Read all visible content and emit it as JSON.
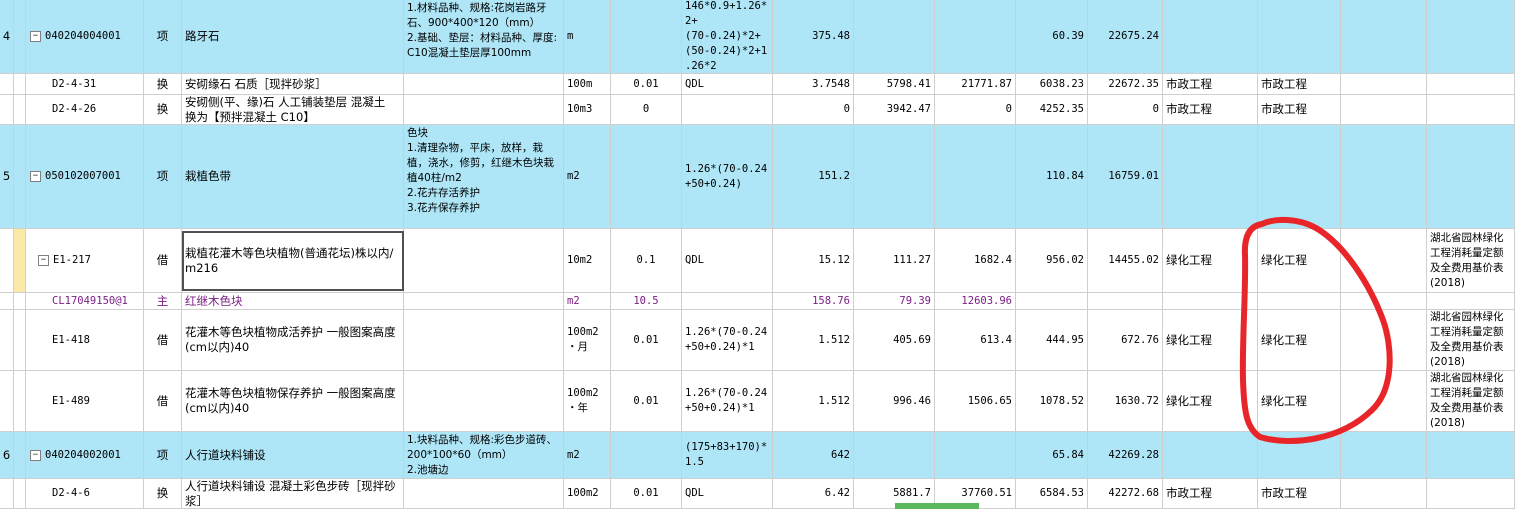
{
  "rows": [
    {
      "no": "4",
      "code": "040204004001",
      "type": "项",
      "name": "路牙石",
      "features": "1.材料品种、规格:花岗岩路牙石、900*400*120（mm）\n2.基础、垫层：材料品种、厚度:C10混凝土垫层厚100mm",
      "unit": "m",
      "qty_coef": "",
      "formula": "146*0.9+1.26*2+\n(70-0.24)*2+\n(50-0.24)*2+1\n.26*2",
      "quantity": "375.48",
      "price1": "",
      "total1": "",
      "unit_price": "60.39",
      "amount": "22675.24",
      "cat1": "",
      "cat2": "",
      "quota_lib": ""
    },
    {
      "no": "",
      "code": "D2-4-31",
      "type": "换",
      "name": "安砌缘石 石质［现拌砂浆］",
      "features": "",
      "unit": "100m",
      "qty_coef": "0.01",
      "formula": "QDL",
      "quantity": "3.7548",
      "price1": "5798.41",
      "total1": "21771.87",
      "unit_price": "6038.23",
      "amount": "22672.35",
      "cat1": "市政工程",
      "cat2": "市政工程",
      "quota_lib": ""
    },
    {
      "no": "",
      "code": "D2-4-26",
      "type": "换",
      "name": "安砌侧(平、缘)石 人工铺装垫层 混凝土 换为【预拌混凝土 C10】",
      "features": "",
      "unit": "10m3",
      "qty_coef": "0",
      "formula": "",
      "quantity": "0",
      "price1": "3942.47",
      "total1": "0",
      "unit_price": "4252.35",
      "amount": "0",
      "cat1": "市政工程",
      "cat2": "市政工程",
      "quota_lib": ""
    },
    {
      "no": "5",
      "code": "050102007001",
      "type": "项",
      "name": "栽植色带",
      "features": "色块\n1.清理杂物，平床，放样，栽植，浇水，修剪，红继木色块栽植40柱/m2\n2.花卉存活养护\n3.花卉保存养护",
      "unit": "m2",
      "qty_coef": "",
      "formula": "1.26*(70-0.24\n+50+0.24)",
      "quantity": "151.2",
      "price1": "",
      "total1": "",
      "unit_price": "110.84",
      "amount": "16759.01",
      "cat1": "",
      "cat2": "",
      "quota_lib": ""
    },
    {
      "no": "",
      "code": "E1-217",
      "type": "借",
      "name": "栽植花灌木等色块植物(普通花坛)株以内/m216",
      "features": "",
      "unit": "10m2",
      "qty_coef": "0.1",
      "formula": "QDL",
      "quantity": "15.12",
      "price1": "111.27",
      "total1": "1682.4",
      "unit_price": "956.02",
      "amount": "14455.02",
      "cat1": "绿化工程",
      "cat2": "绿化工程",
      "quota_lib": "湖北省园林绿化工程消耗量定额及全费用基价表(2018)"
    },
    {
      "no": "",
      "code": "CL17049150@1",
      "type": "主",
      "name": "红继木色块",
      "features": "",
      "unit": "m2",
      "qty_coef": "10.5",
      "formula": "",
      "quantity": "158.76",
      "price1": "79.39",
      "total1": "12603.96",
      "unit_price": "",
      "amount": "",
      "cat1": "",
      "cat2": "",
      "quota_lib": ""
    },
    {
      "no": "",
      "code": "E1-418",
      "type": "借",
      "name": "花灌木等色块植物成活养护 一般图案高度(cm以内)40",
      "features": "",
      "unit": "100m2\n・月",
      "qty_coef": "0.01",
      "formula": "1.26*(70-0.24\n+50+0.24)*1",
      "quantity": "1.512",
      "price1": "405.69",
      "total1": "613.4",
      "unit_price": "444.95",
      "amount": "672.76",
      "cat1": "绿化工程",
      "cat2": "绿化工程",
      "quota_lib": "湖北省园林绿化工程消耗量定额及全费用基价表(2018)"
    },
    {
      "no": "",
      "code": "E1-489",
      "type": "借",
      "name": "花灌木等色块植物保存养护 一般图案高度(cm以内)40",
      "features": "",
      "unit": "100m2\n・年",
      "qty_coef": "0.01",
      "formula": "1.26*(70-0.24\n+50+0.24)*1",
      "quantity": "1.512",
      "price1": "996.46",
      "total1": "1506.65",
      "unit_price": "1078.52",
      "amount": "1630.72",
      "cat1": "绿化工程",
      "cat2": "绿化工程",
      "quota_lib": "湖北省园林绿化工程消耗量定额及全费用基价表(2018)"
    },
    {
      "no": "6",
      "code": "040204002001",
      "type": "项",
      "name": "人行道块料铺设",
      "features": "1.块料品种、规格:彩色步道砖、200*100*60（mm）\n2.池塘边",
      "unit": "m2",
      "qty_coef": "",
      "formula": "(175+83+170)*\n1.5",
      "quantity": "642",
      "price1": "",
      "total1": "",
      "unit_price": "65.84",
      "amount": "42269.28",
      "cat1": "",
      "cat2": "",
      "quota_lib": ""
    },
    {
      "no": "",
      "code": "D2-4-6",
      "type": "换",
      "name": "人行道块料铺设 混凝土彩色步砖［现拌砂浆］",
      "features": "",
      "unit": "100m2",
      "qty_coef": "0.01",
      "formula": "QDL",
      "quantity": "6.42",
      "price1": "5881.7",
      "total1": "37760.51",
      "unit_price": "6584.53",
      "amount": "42272.68",
      "cat1": "市政工程",
      "cat2": "市政工程",
      "quota_lib": ""
    }
  ],
  "colors": {
    "header_row": "#aee6f8",
    "child_code": "#7b1e86",
    "annotation": "#e8262a",
    "scroll_thumb": "#5cb85c"
  }
}
